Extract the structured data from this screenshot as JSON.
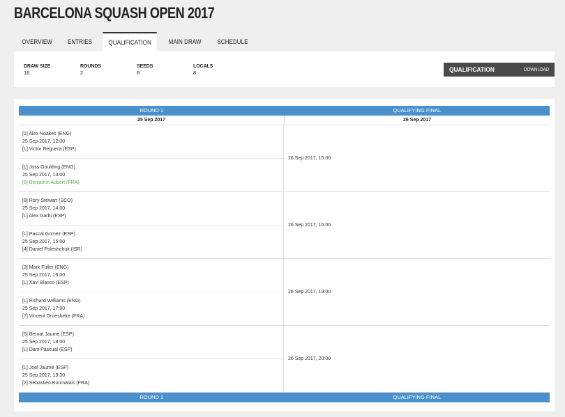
{
  "page": {
    "title": "BARCELONA SQUASH OPEN 2017"
  },
  "tabs": [
    {
      "label": "OVERVIEW",
      "active": false
    },
    {
      "label": "ENTRIES",
      "active": false
    },
    {
      "label": "QUALIFICATION",
      "active": true
    },
    {
      "label": "MAIN DRAW",
      "active": false
    },
    {
      "label": "SCHEDULE",
      "active": false
    }
  ],
  "info": [
    {
      "label": "DRAW SIZE",
      "value": "16"
    },
    {
      "label": "ROUNDS",
      "value": "2"
    },
    {
      "label": "SEEDS",
      "value": "8"
    },
    {
      "label": "LOCALS",
      "value": "8"
    }
  ],
  "qual_button": {
    "label": "QUALIFICATION",
    "download": "DOWNLOAD"
  },
  "draw": {
    "headers": [
      "ROUND 1",
      "QUALIFYING FINAL"
    ],
    "dates": [
      "25 Sep 2017",
      "26 Sep 2017"
    ],
    "round1": [
      {
        "p1": "[1] Alex Noakes (ENG)",
        "time": "25 Sep 2017, 12:00",
        "p2": "[L] Victor Reguera (ESP)",
        "p2win": false
      },
      {
        "p1": "[L] Joss Goulding (ENG)",
        "time": "25 Sep 2017, 13:00",
        "p2": "[6] Benjamin Aubert (FRA)",
        "p2win": true
      },
      {
        "p1": "[8] Rory Stewart (SCO)",
        "time": "25 Sep 2017, 14:00",
        "p2": "[L] Alex Garbi (ESP)",
        "p2win": false
      },
      {
        "p1": "[L] Pascal Gomez (ESP)",
        "time": "25 Sep 2017, 15:00",
        "p2": "[4] Daniel Poleshchuk (ISR)",
        "p2win": false
      },
      {
        "p1": "[3] Mark Fuller (ENG)",
        "time": "25 Sep 2017, 16:00",
        "p2": "[L] Xavi Blasco (ESP)",
        "p2win": false
      },
      {
        "p1": "[L] Richard Williams (ENG)",
        "time": "25 Sep 2017, 17:00",
        "p2": "[7] Vincent Droesbeke (FRA)",
        "p2win": false
      },
      {
        "p1": "[5] Bernat Jaume (ESP)",
        "time": "25 Sep 2017, 18:00",
        "p2": "[L] Dani Pascual (ESP)",
        "p2win": false
      },
      {
        "p1": "[L] Joel Jaume (ESP)",
        "time": "25 Sep 2017, 19:30",
        "p2": "[2] Sebastien Bonmalais (FRA)",
        "p2win": false
      }
    ],
    "finals": [
      "26 Sep 2017, 15:00",
      "26 Sep 2017, 16:00",
      "26 Sep 2017, 19:00",
      "26 Sep 2017, 20:00"
    ]
  }
}
